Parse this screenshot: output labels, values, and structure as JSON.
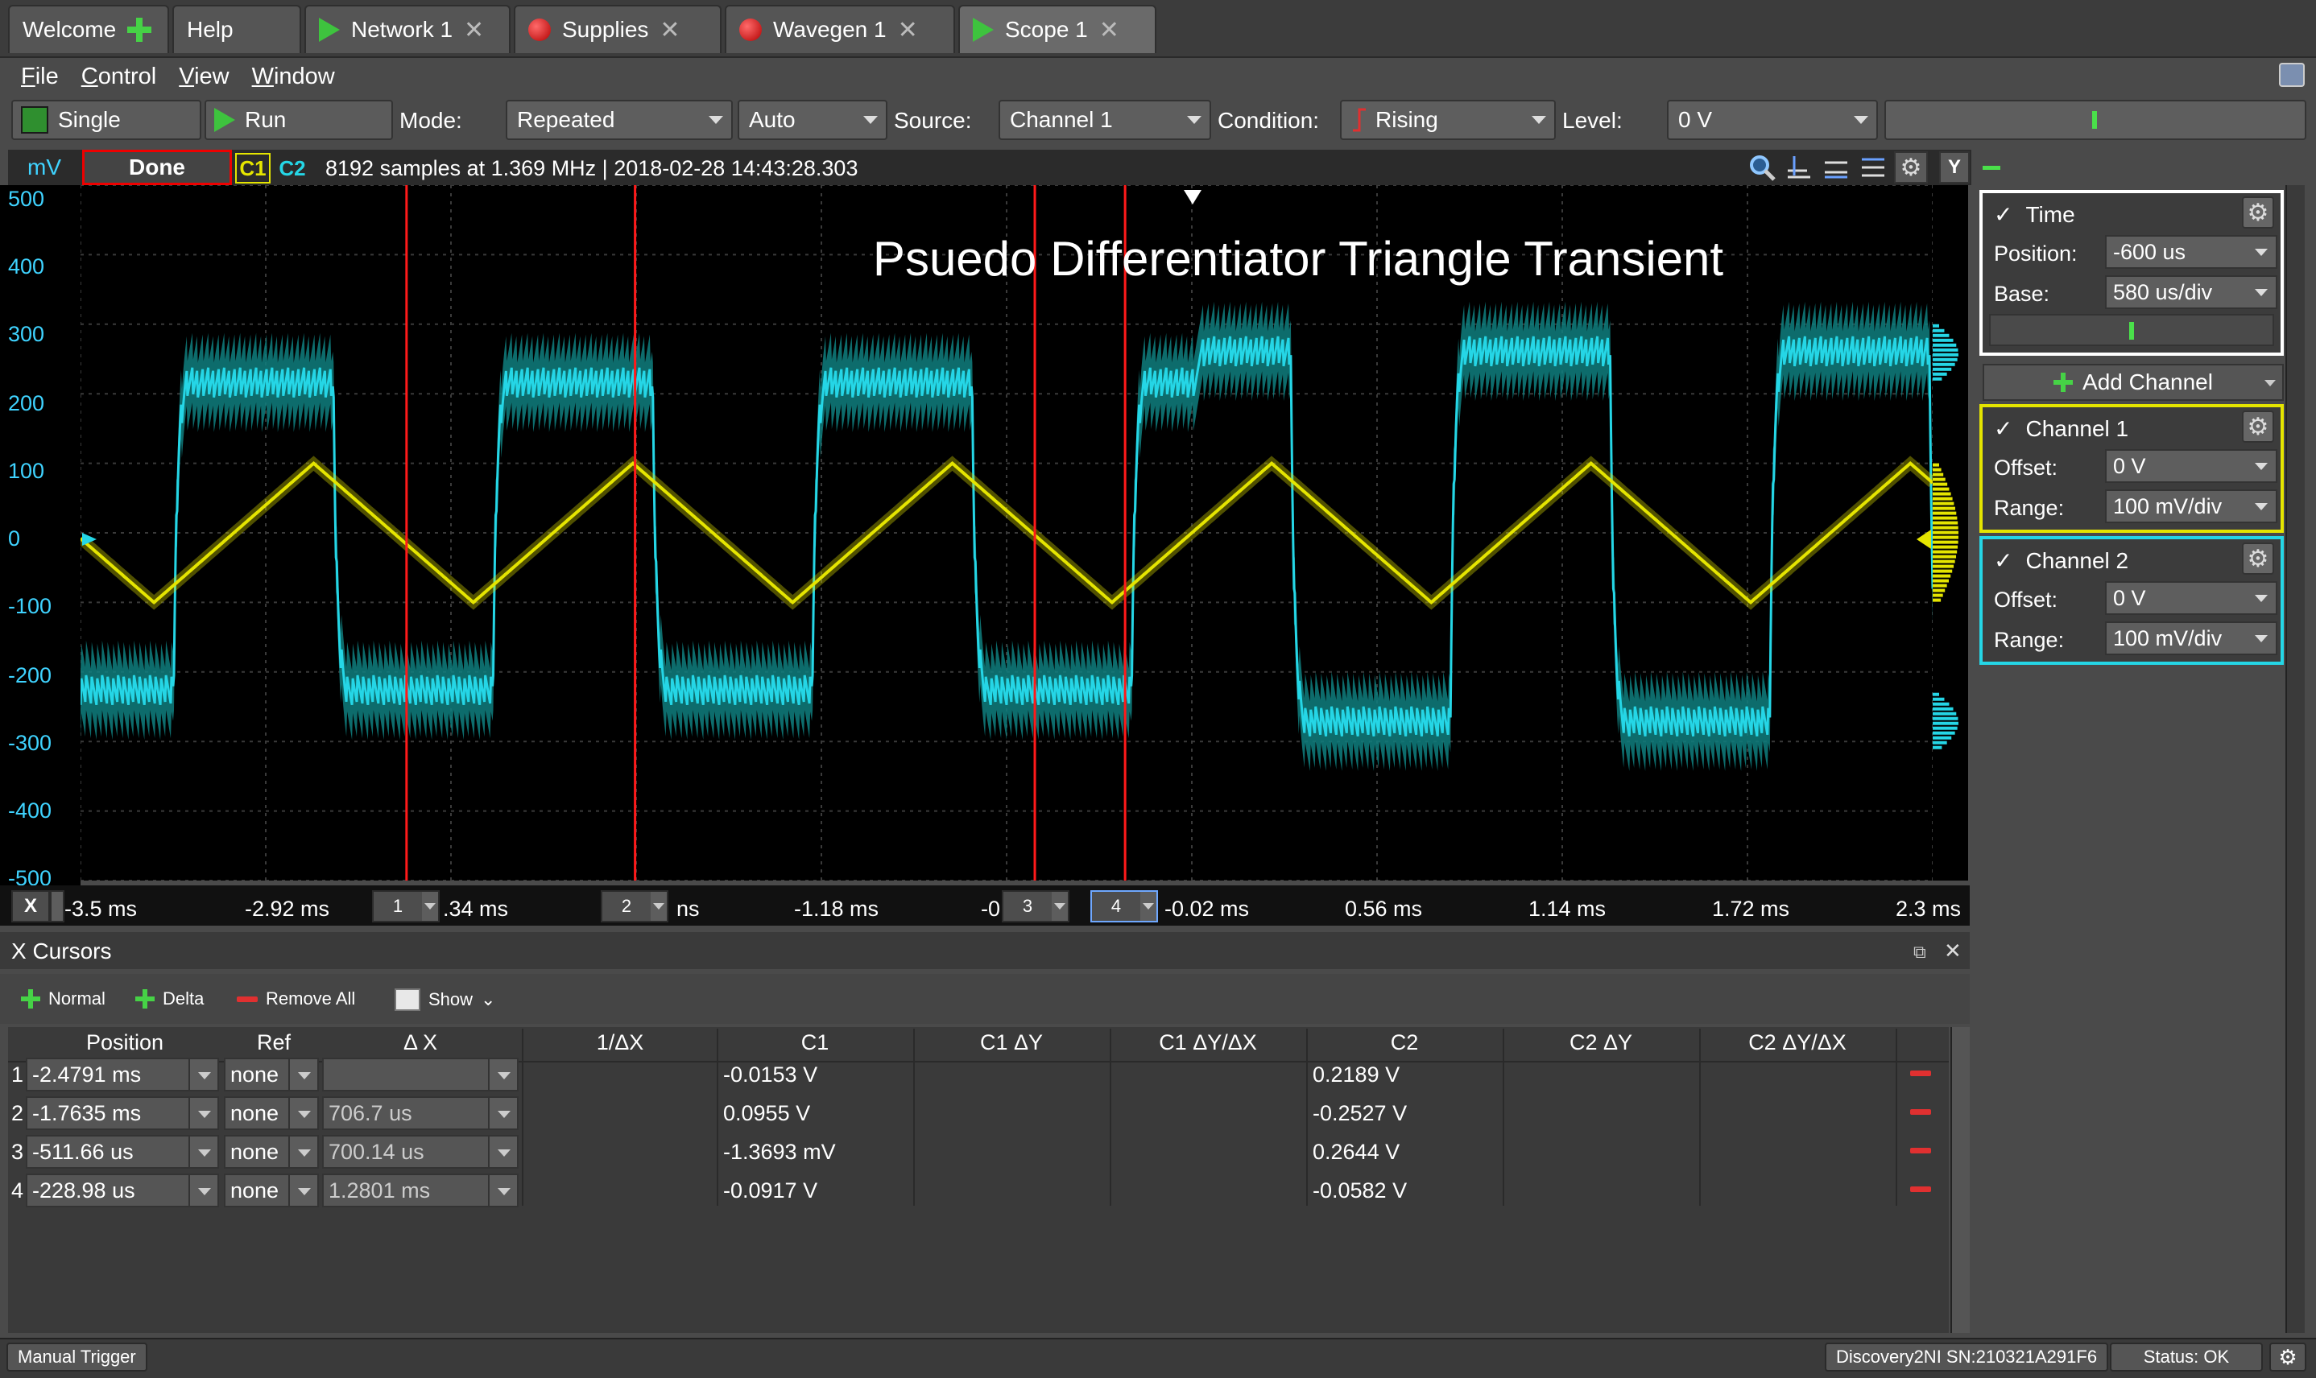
{
  "tabs": [
    {
      "label": "Welcome",
      "icon": "plus-icon"
    },
    {
      "label": "Help"
    },
    {
      "label": "Network 1",
      "icon": "play-icon"
    },
    {
      "label": "Supplies",
      "icon": "record-icon"
    },
    {
      "label": "Wavegen 1",
      "icon": "record-icon"
    },
    {
      "label": "Scope 1",
      "icon": "play-icon"
    }
  ],
  "menu": [
    "File",
    "Control",
    "View",
    "Window"
  ],
  "toolbar": {
    "single_label": "Single",
    "run_label": "Run",
    "mode_label": "Mode:",
    "mode_value": "Repeated",
    "auto_value": "Auto",
    "source_label": "Source:",
    "source_value": "Channel 1",
    "condition_label": "Condition:",
    "condition_value": "Rising",
    "level_label": "Level:",
    "level_value": "0 V"
  },
  "scope": {
    "unit": "mV",
    "status": "Done",
    "c1_badge": "C1",
    "c2_badge": "C2",
    "samples_info": "8192 samples at 1.369 MHz | 2018-02-28 14:43:28.303",
    "title": "Psuedo Differentiator Triangle Transient",
    "y_button": "Y",
    "y_ticks": [
      "500",
      "400",
      "300",
      "200",
      "100",
      "0",
      "-100",
      "-200",
      "-300",
      "-400",
      "-500"
    ],
    "x_ticks": [
      "-3.5 ms",
      "-2.92 ms",
      ".34 ms",
      "ns",
      "-1.18 ms",
      "-0",
      "-0.02 ms",
      "0.56 ms",
      "1.14 ms",
      "1.72 ms",
      "2.3 ms"
    ],
    "x_toggle": "X",
    "cursor_tabs": [
      "1",
      "2",
      "3",
      "4"
    ]
  },
  "chart_data": {
    "type": "line",
    "xlabel": "",
    "ylabel": "mV",
    "xlim": [
      -3.5,
      2.3
    ],
    "ylim": [
      -500,
      500
    ],
    "x_unit": "ms",
    "grid": true,
    "series": [
      {
        "name": "C1",
        "color": "#e5e500",
        "shape": "triangle",
        "period_ms": 1.0,
        "amplitude_mV": 100,
        "first_peak_ms": -2.77
      },
      {
        "name": "C2",
        "color": "#25d6e6",
        "shape": "square-noisy",
        "period_ms": 1.0,
        "high_mV": 260,
        "low_mV": -270,
        "noise_band_mV": 50
      }
    ],
    "cursors_ms": [
      -2.4791,
      -1.7635,
      -0.51166,
      -0.22898
    ],
    "trigger_marker_ms": 0
  },
  "time_panel": {
    "title": "Time",
    "position_label": "Position:",
    "position_value": "-600 us",
    "base_label": "Base:",
    "base_value": "580 us/div"
  },
  "add_channel": "Add Channel",
  "channel1": {
    "title": "Channel 1",
    "offset_label": "Offset:",
    "offset_value": "0 V",
    "range_label": "Range:",
    "range_value": "100 mV/div",
    "color": "#e5e500"
  },
  "channel2": {
    "title": "Channel 2",
    "offset_label": "Offset:",
    "offset_value": "0 V",
    "range_label": "Range:",
    "range_value": "100 mV/div",
    "color": "#25d6e6"
  },
  "cursors": {
    "title": "X Cursors",
    "normal": "Normal",
    "delta": "Delta",
    "remove_all": "Remove All",
    "show": "Show",
    "headers": [
      "Position",
      "Ref",
      "Δ X",
      "1/ΔX",
      "C1",
      "C1 ΔY",
      "C1 ΔY/ΔX",
      "C2",
      "C2 ΔY",
      "C2 ΔY/ΔX"
    ],
    "rows": [
      {
        "n": "1",
        "position": "-2.4791 ms",
        "ref": "none",
        "dx": "",
        "c1": "-0.0153 V",
        "c2": "0.2189 V"
      },
      {
        "n": "2",
        "position": "-1.7635 ms",
        "ref": "none",
        "dx": "706.7 us",
        "c1": "0.0955 V",
        "c2": "-0.2527 V"
      },
      {
        "n": "3",
        "position": "-511.66 us",
        "ref": "none",
        "dx": "700.14 us",
        "c1": "-1.3693 mV",
        "c2": "0.2644 V"
      },
      {
        "n": "4",
        "position": "-228.98 us",
        "ref": "none",
        "dx": "1.2801 ms",
        "c1": "-0.0917 V",
        "c2": "-0.0582 V"
      }
    ]
  },
  "status": {
    "manual_trigger": "Manual Trigger",
    "device": "Discovery2NI SN:210321A291F6",
    "status": "Status: OK"
  }
}
